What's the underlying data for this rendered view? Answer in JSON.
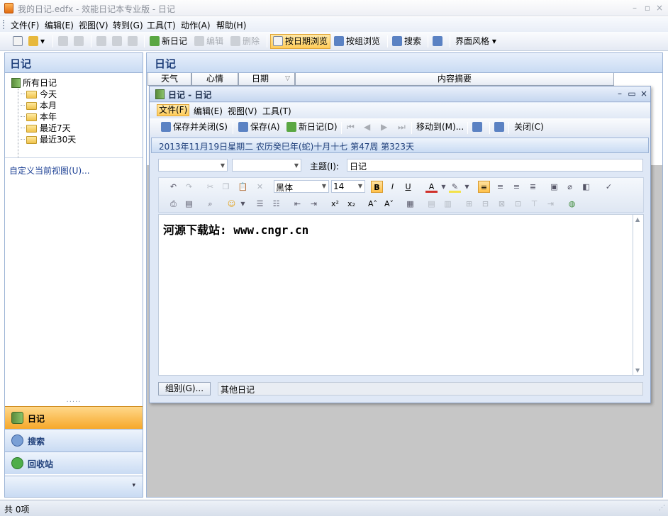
{
  "window": {
    "title": "我的日记.edfx - 效能日记本专业版 - 日记",
    "min": "–",
    "restore": "▫",
    "close": "×"
  },
  "menu": [
    "文件(F)",
    "编辑(E)",
    "视图(V)",
    "转到(G)",
    "工具(T)",
    "动作(A)",
    "帮助(H)"
  ],
  "toolbar": {
    "new_diary": "新日记",
    "edit": "编辑",
    "delete": "删除",
    "by_date": "按日期浏览",
    "by_group": "按组浏览",
    "search": "搜索",
    "theme": "界面风格"
  },
  "left": {
    "header": "日记",
    "tree_root": "所有日记",
    "tree_items": [
      "今天",
      "本月",
      "本年",
      "最近7天",
      "最近30天"
    ],
    "custom_view": "自定义当前视图(U)...",
    "nav": [
      "日记",
      "搜索",
      "回收站"
    ]
  },
  "right": {
    "header": "日记",
    "columns": [
      "天气",
      "心情",
      "日期",
      "内容摘要"
    ]
  },
  "dialog": {
    "title": "日记 - 日记",
    "menu": [
      "文件(F)",
      "编辑(E)",
      "视图(V)",
      "工具(T)"
    ],
    "tools": {
      "save_close": "保存并关闭(S)",
      "save": "保存(A)",
      "new_diary": "新日记(D)",
      "move_to": "移动到(M)...",
      "close": "关闭(C)"
    },
    "date_line": "2013年11月19日星期二 农历癸巳年(蛇)十月十七  第47周 第323天",
    "subject_label": "主题(I):",
    "subject_value": "日记",
    "font_name": "黑体",
    "font_size": "14",
    "editor_text": "河源下载站: www.cngr.cn",
    "group_button": "组别(G)...",
    "group_value": "其他日记"
  },
  "status": "共 0项",
  "colors": {
    "accent_orange": "#f6a82a",
    "panel_blue": "#c9dbf3",
    "link_blue": "#1b3f94"
  }
}
